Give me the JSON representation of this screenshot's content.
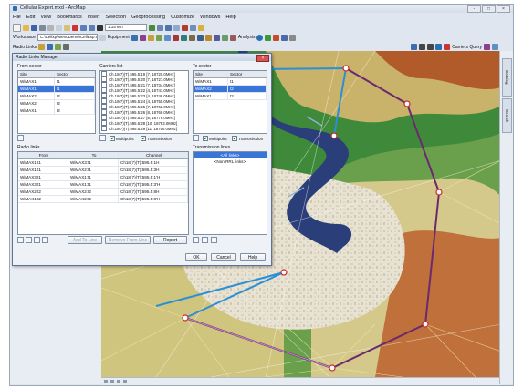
{
  "window": {
    "title": "Cellular Expert.mxd - ArcMap",
    "controls": [
      "-",
      "□",
      "×"
    ]
  },
  "menu": [
    "File",
    "Edit",
    "View",
    "Bookmarks",
    "Insert",
    "Selection",
    "Geoprocessing",
    "Customize",
    "Windows",
    "Help"
  ],
  "toolbar": {
    "scale": "1:15 667",
    "workspace_label": "Workspace",
    "workspace_value": "C:\\Cellxp\\MenoDemo\\CellExp.mdb",
    "equipment_label": "Equipment",
    "analysis_label": "Analysis",
    "carriers_query_label": "Carriers Query",
    "radio_links_label": "Radio Links"
  },
  "right_dock": [
    "Catalog",
    "Search"
  ],
  "dialog": {
    "title": "Radio Links Manager",
    "close": "×",
    "from_sector": {
      "label": "From sector",
      "headers": [
        "Site",
        "Sector"
      ],
      "rows": [
        [
          "WiMAX1",
          "t1"
        ],
        [
          "WiMAX1",
          "t1"
        ],
        [
          "WiMAX2",
          "t2"
        ],
        [
          "WiMAX2",
          "t2"
        ],
        [
          "WiMAX1",
          "t2"
        ]
      ],
      "selected_index": 1
    },
    "carriers": {
      "label": "Carriers list",
      "items": [
        "Ch.18(7)(T).595.5:19 [7, 18720.0MHz]",
        "Ch.18(7)(T).595.5:20 [7, 18727.0MHz]",
        "Ch.18(7)(T).595.5:21 [7, 18734.0MHz]",
        "Ch.18(7)(T).595.5:22 [4, 18741.0MHz]",
        "Ch.18(7)(T).595.5:23 [4, 18748.0MHz]",
        "Ch.18(7)(T).595.5:24 [4, 18755.0MHz]",
        "Ch.18(7)(T).595.5:25 [7, 18762.0MHz]",
        "Ch.18(7)(T).595.5:26 [8, 18769.0MHz]",
        "Ch.18(7)(T).595.5:27 [8, 18776.0MHz]",
        "Ch.18(7)(T).595.5:28 [10, 18783.0MHz]",
        "Ch.18(7)(T).595.5:29 [11, 18790.0MHz]"
      ],
      "multipoint_label": "Multipoint",
      "transmission_label": "Transmission"
    },
    "to_sector": {
      "label": "To sector",
      "headers": [
        "Site",
        "Sector"
      ],
      "rows": [
        [
          "WiMAX1",
          "t1"
        ],
        [
          "WiMAX2",
          "t2"
        ],
        [
          "WiMAX1",
          "t2"
        ]
      ],
      "selected_index": 1,
      "multipoint_label": "Multipoint",
      "transmission_label": "Transmission"
    },
    "radio_links": {
      "label": "Radio links",
      "headers": [
        "From",
        "To",
        "Channel"
      ],
      "rows": [
        [
          "WiMAX1:t1",
          "WiMAX3:t1",
          "Ch18(7)(T):595.5:1H"
        ],
        [
          "WiMAX1:t1",
          "WiMAX2:t1",
          "Ch18(7)(T):595.5:3H"
        ],
        [
          "WiMAX3:t1",
          "WiMAX1:t1",
          "Ch18(7)(T):595.5:1'H"
        ],
        [
          "WiMAX3:t1",
          "WiMAX1:t1",
          "Ch18(7)(T):595.5:3'H"
        ],
        [
          "WiMAX2:t2",
          "WiMAX2:t2",
          "Ch18(7)(T):595.5:8H"
        ],
        [
          "WiMAX1:t2",
          "WiMAX2:t2",
          "Ch18(7)(T):595.5:8'H"
        ]
      ],
      "add_to_line": "Add To Line",
      "remove_from_line": "Remove From Line",
      "report": "Report"
    },
    "transmission_lines": {
      "label": "Transmission lines",
      "items": [
        "<All links>",
        "<Non RRL links>"
      ],
      "selected_index": 0
    },
    "ok": "OK",
    "cancel": "Cancel",
    "help": "Help"
  },
  "colors": {
    "accent": "#3875d7",
    "link_blue": "#2b8fd6",
    "link_purple": "#6b2a6e",
    "river": "#2a3f7a"
  }
}
